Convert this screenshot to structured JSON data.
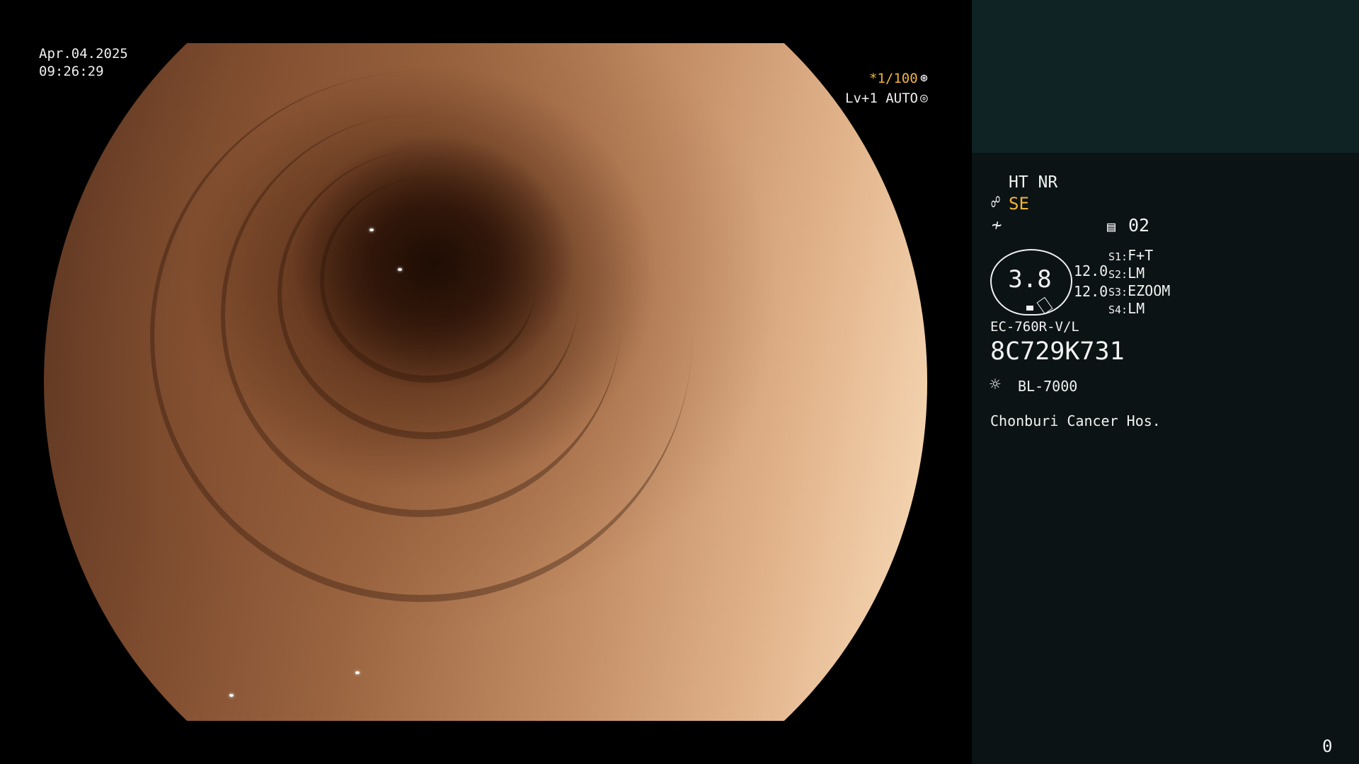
{
  "overlay": {
    "date": "Apr.04.2025",
    "time": "09:26:29",
    "shutter": "*1/100",
    "shutter_icon": "⊛",
    "level": "Lv+1 AUTO",
    "iris_icon": "◎"
  },
  "panel": {
    "enhance": "HT NR",
    "structure_icon": "☍",
    "structure_mode": "SE",
    "slash_icon": "≁",
    "record_icon": "▤",
    "record_no": "02",
    "scope_value": "3.8",
    "values": [
      "12.0",
      "12.0"
    ],
    "switches": [
      {
        "key": "S1:",
        "label": "F+T"
      },
      {
        "key": "S2:",
        "label": "LM"
      },
      {
        "key": "S3:",
        "label": "EZOOM"
      },
      {
        "key": "S4:",
        "label": "LM"
      }
    ],
    "scope_model": "EC-760R-V/L",
    "scope_serial": "8C729K731",
    "lamp_icon": "☼",
    "light_source": "BL-7000",
    "hospital": "Chonburi Cancer Hos.",
    "page_counter": "0"
  },
  "colors": {
    "accent_orange": "#f2b43a",
    "panel_bg": "#0b1314",
    "thumbnail_bg": "#0f2324"
  }
}
